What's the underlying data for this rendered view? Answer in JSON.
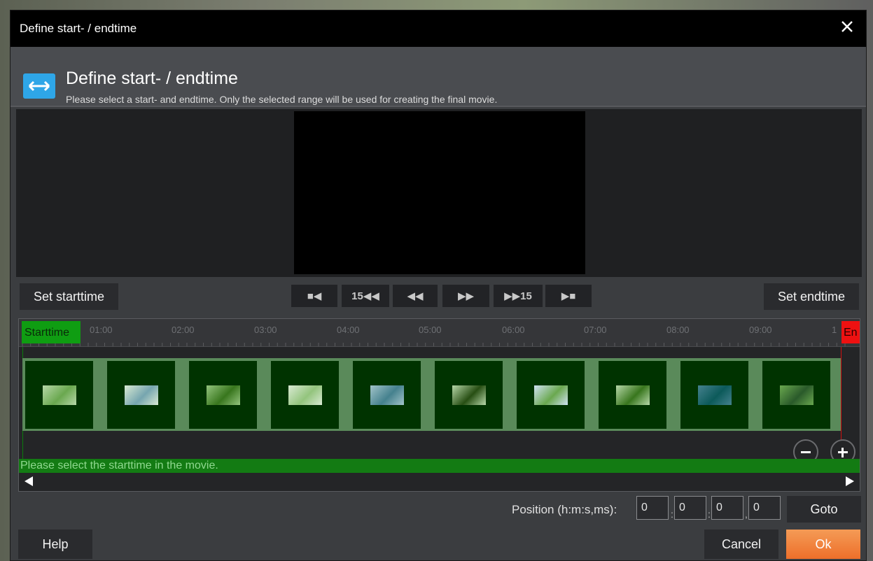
{
  "dialog": {
    "window_title": "Define start- / endtime",
    "heading": "Define start- / endtime",
    "subtitle": "Please select a start- and endtime. Only the selected range will be used for creating the final movie."
  },
  "controls": {
    "set_start_label": "Set starttime",
    "set_end_label": "Set endtime",
    "transport": [
      {
        "name": "stop-back",
        "label": "■◀"
      },
      {
        "name": "back-15",
        "label": "15◀◀"
      },
      {
        "name": "rewind",
        "label": "◀◀"
      },
      {
        "name": "forward",
        "label": "▶▶"
      },
      {
        "name": "forward-15",
        "label": "▶▶15"
      },
      {
        "name": "play-stop",
        "label": "▶■"
      }
    ]
  },
  "timeline": {
    "start_tag": "Starttime",
    "end_tag": "En",
    "ticks": [
      "01:00",
      "02:00",
      "03:00",
      "04:00",
      "05:00",
      "06:00",
      "07:00",
      "08:00",
      "09:00",
      "1"
    ],
    "status_text": "Please select the starttime in the movie.",
    "thumbnail_count": 10
  },
  "position": {
    "label": "Position (h:m:s,ms):",
    "hours": "0",
    "minutes": "0",
    "seconds": "0",
    "ms": "0",
    "goto_label": "Goto"
  },
  "footer": {
    "help_label": "Help",
    "cancel_label": "Cancel",
    "ok_label": "Ok"
  },
  "colors": {
    "accent_ok": "#f07e3a",
    "start_green": "#0f9d12",
    "end_red": "#ee1111",
    "icon_blue": "#2ea6e8"
  }
}
